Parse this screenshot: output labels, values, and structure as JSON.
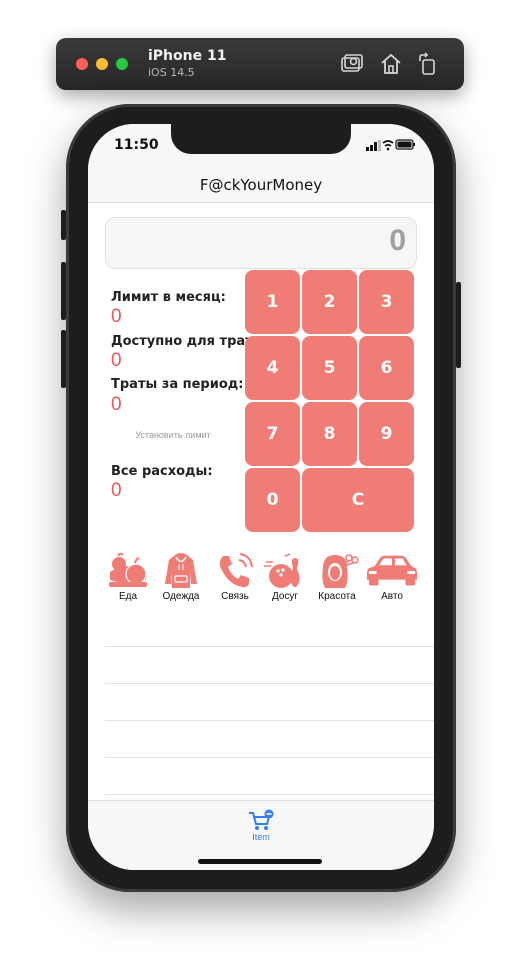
{
  "simulator": {
    "device": "iPhone 11",
    "os": "iOS 14.5",
    "buttons": [
      "screenshot-icon",
      "home-icon",
      "rotate-icon"
    ]
  },
  "status_bar": {
    "time": "11:50"
  },
  "nav": {
    "title": "F@ckYourMoney"
  },
  "display": {
    "value": "0"
  },
  "info": {
    "monthly_limit_label": "Лимит в месяц:",
    "monthly_limit_value": "0",
    "available_label": "Доступно для трат:",
    "available_value": "0",
    "period_spending_label": "Траты за период:",
    "period_spending_value": "0",
    "set_limit_link": "Установить лимит",
    "total_label": "Все расходы:",
    "total_value": "0"
  },
  "keypad": {
    "k1": "1",
    "k2": "2",
    "k3": "3",
    "k4": "4",
    "k5": "5",
    "k6": "6",
    "k7": "7",
    "k8": "8",
    "k9": "9",
    "k0": "0",
    "clear": "C"
  },
  "categories": {
    "food": "Еда",
    "clothes": "Одежда",
    "communication": "Связь",
    "leisure": "Досуг",
    "beauty": "Красота",
    "auto": "Авто"
  },
  "tab_bar": {
    "item_label": "Item",
    "item_icon": "cart-icon"
  },
  "colors": {
    "accent": "#f07c76",
    "value_red": "#e8585a",
    "tab_blue": "#2f80ed"
  }
}
